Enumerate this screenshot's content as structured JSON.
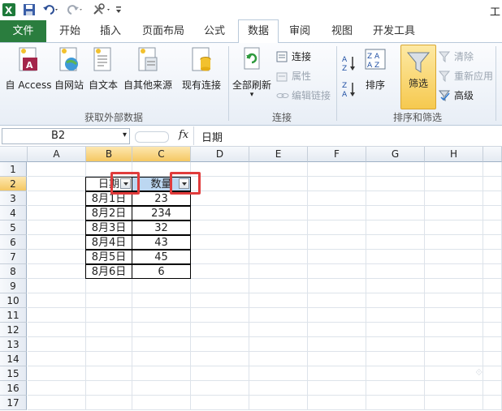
{
  "window": {
    "title_fragment": "工"
  },
  "tabs": [
    "文件",
    "开始",
    "插入",
    "页面布局",
    "公式",
    "数据",
    "审阅",
    "视图",
    "开发工具"
  ],
  "active_tab": "数据",
  "ribbon": {
    "external": {
      "access": "自 Access",
      "web": "自网站",
      "text": "自文本",
      "other": "自其他来源",
      "existing": "现有连接",
      "group": "获取外部数据"
    },
    "connections": {
      "refresh": "全部刷新",
      "connect": "连接",
      "props": "属性",
      "edit": "编辑链接",
      "group": "连接"
    },
    "sort": {
      "sort": "排序",
      "filter": "筛选",
      "clear": "清除",
      "reapply": "重新应用",
      "advanced": "高级",
      "group": "排序和筛选"
    }
  },
  "formula_bar": {
    "name_box": "B2",
    "fx": "fx",
    "content": "日期"
  },
  "columns": [
    "A",
    "B",
    "C",
    "D",
    "E",
    "F",
    "G",
    "H"
  ],
  "rows": [
    "1",
    "2",
    "3",
    "4",
    "5",
    "6",
    "7",
    "8",
    "9",
    "10",
    "11",
    "12",
    "13",
    "14",
    "15",
    "16",
    "17"
  ],
  "table": {
    "headers": [
      "日期",
      "数量"
    ],
    "rows": [
      [
        "8月1日",
        "23"
      ],
      [
        "8月2日",
        "234"
      ],
      [
        "8月3日",
        "32"
      ],
      [
        "8月4日",
        "43"
      ],
      [
        "8月5日",
        "45"
      ],
      [
        "8月6日",
        "6"
      ]
    ]
  },
  "accent": {
    "file_tab": "#2a7d3e",
    "highlight_box": "#e03c3c",
    "selection": "#f5c862"
  }
}
